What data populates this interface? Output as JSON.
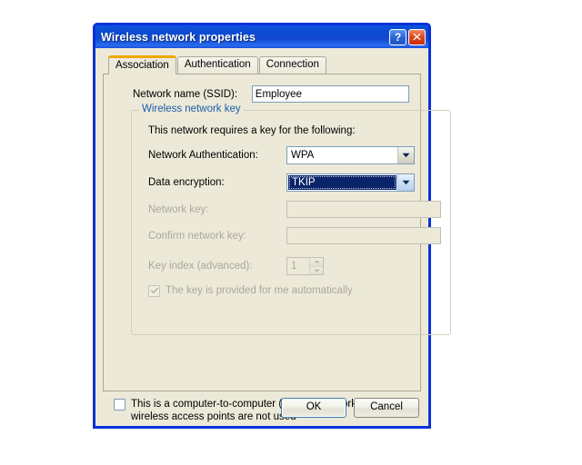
{
  "window": {
    "title": "Wireless network properties",
    "help_button": "?",
    "close_button": "x"
  },
  "tabs": [
    {
      "label": "Association",
      "active": true
    },
    {
      "label": "Authentication",
      "active": false
    },
    {
      "label": "Connection",
      "active": false
    }
  ],
  "association": {
    "ssid": {
      "label": "Network name (SSID):",
      "value": "Employee",
      "placeholder": ""
    },
    "network_key_group": {
      "legend": "Wireless network key",
      "intro": "This network requires a key for the following:",
      "network_authentication": {
        "label": "Network Authentication:",
        "value": "WPA",
        "focused": false
      },
      "data_encryption": {
        "label": "Data encryption:",
        "value": "TKIP",
        "focused": true
      },
      "network_key": {
        "label": "Network key:",
        "value": "",
        "disabled": true
      },
      "confirm_network_key": {
        "label": "Confirm network key:",
        "value": "",
        "disabled": true
      },
      "key_index": {
        "label": "Key index (advanced):",
        "value": "1",
        "disabled": true
      },
      "auto_key": {
        "label": "The key is provided for me automatically",
        "checked": true,
        "disabled": true
      }
    },
    "ad_hoc": {
      "label": "This is a computer-to-computer (ad hoc) network; wireless access points are not used",
      "checked": false
    }
  },
  "footer": {
    "ok_label": "OK",
    "cancel_label": "Cancel"
  },
  "colors": {
    "titlebar_blue": "#0b4fd6",
    "dialog_face": "#ece9d8",
    "frame_blue": "#0831d9",
    "active_tab_accent": "#f0a800",
    "group_legend_blue": "#1b5faa",
    "selection_blue": "#0a246a",
    "disabled_text": "#aca899",
    "input_border": "#7f9db9"
  }
}
